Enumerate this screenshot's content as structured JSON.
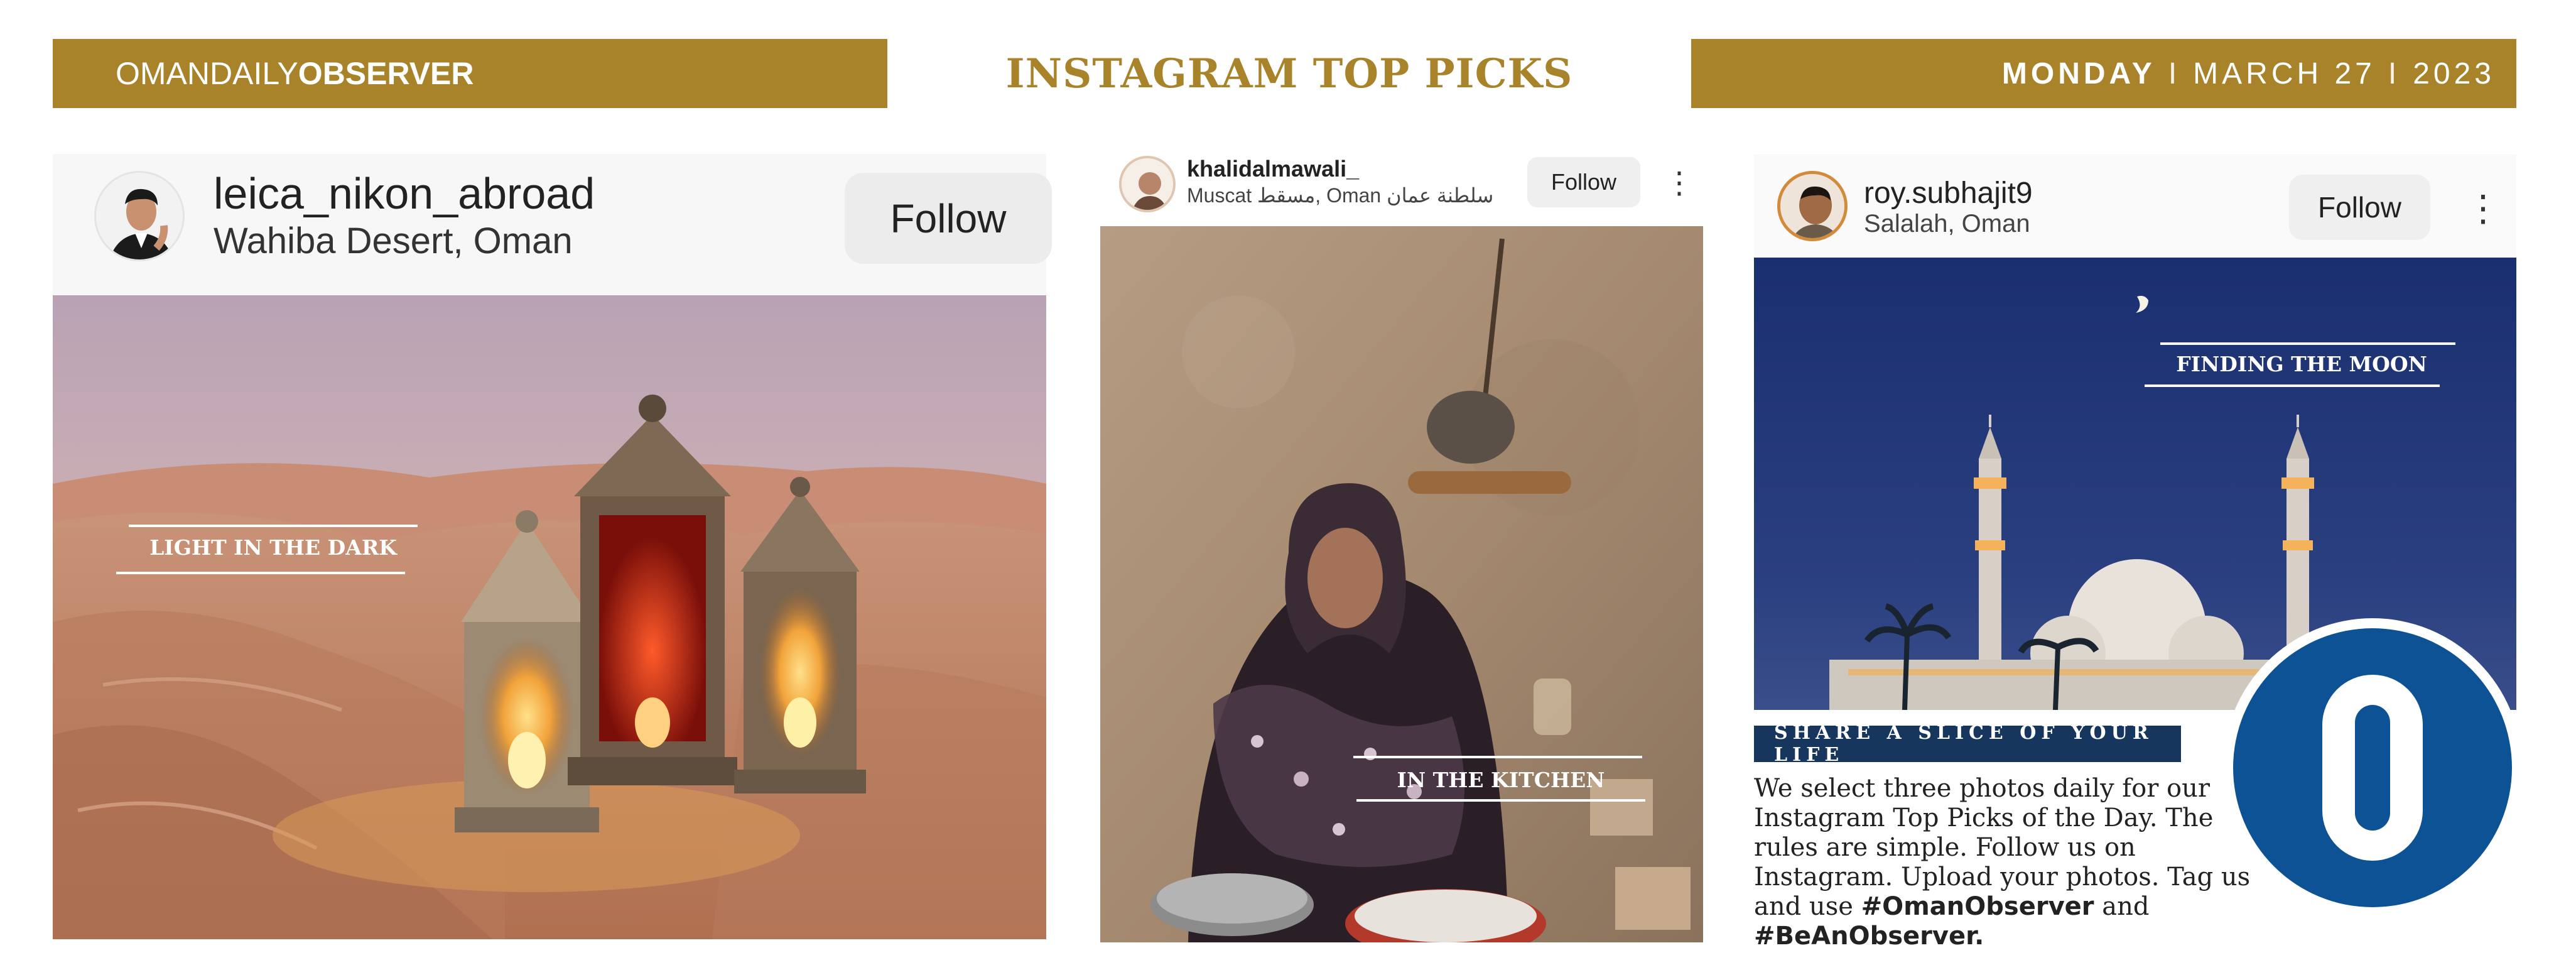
{
  "header": {
    "masthead_light": "OMANDAILY",
    "masthead_bold": "OBSERVER",
    "section_title": "INSTAGRAM TOP PICKS",
    "date_day": "MONDAY",
    "date_month_day": "MARCH 27",
    "date_year": "2023",
    "date_separator": "I"
  },
  "posts": [
    {
      "username": "leica_nikon_abroad",
      "location": "Wahiba Desert, Oman",
      "follow_label": "Follow",
      "caption": "LIGHT IN THE DARK"
    },
    {
      "username": "khalidalmawali_",
      "location": "Muscat مسقط, Oman سلطنة عمان",
      "follow_label": "Follow",
      "more_icon": "⋮",
      "caption": "IN THE KITCHEN"
    },
    {
      "username": "roy.subhajit9",
      "location": "Salalah, Oman",
      "follow_label": "Follow",
      "more_icon": "⋮",
      "caption": "FINDING THE MOON"
    }
  ],
  "share": {
    "banner": "SHARE A SLICE OF YOUR LIFE",
    "body": "We select three photos daily for our Instagram Top Picks of the Day. The rules are simple. Follow us on Instagram. Upload your photos. Tag us and use",
    "hashtag1": "#OmanObserver",
    "and_word": "and",
    "hashtag2": "#BeAnObserver."
  },
  "logo": {
    "letter": "O",
    "color": "#0c5294"
  },
  "colors": {
    "gold": "#a8832a",
    "navy": "#16365d"
  }
}
